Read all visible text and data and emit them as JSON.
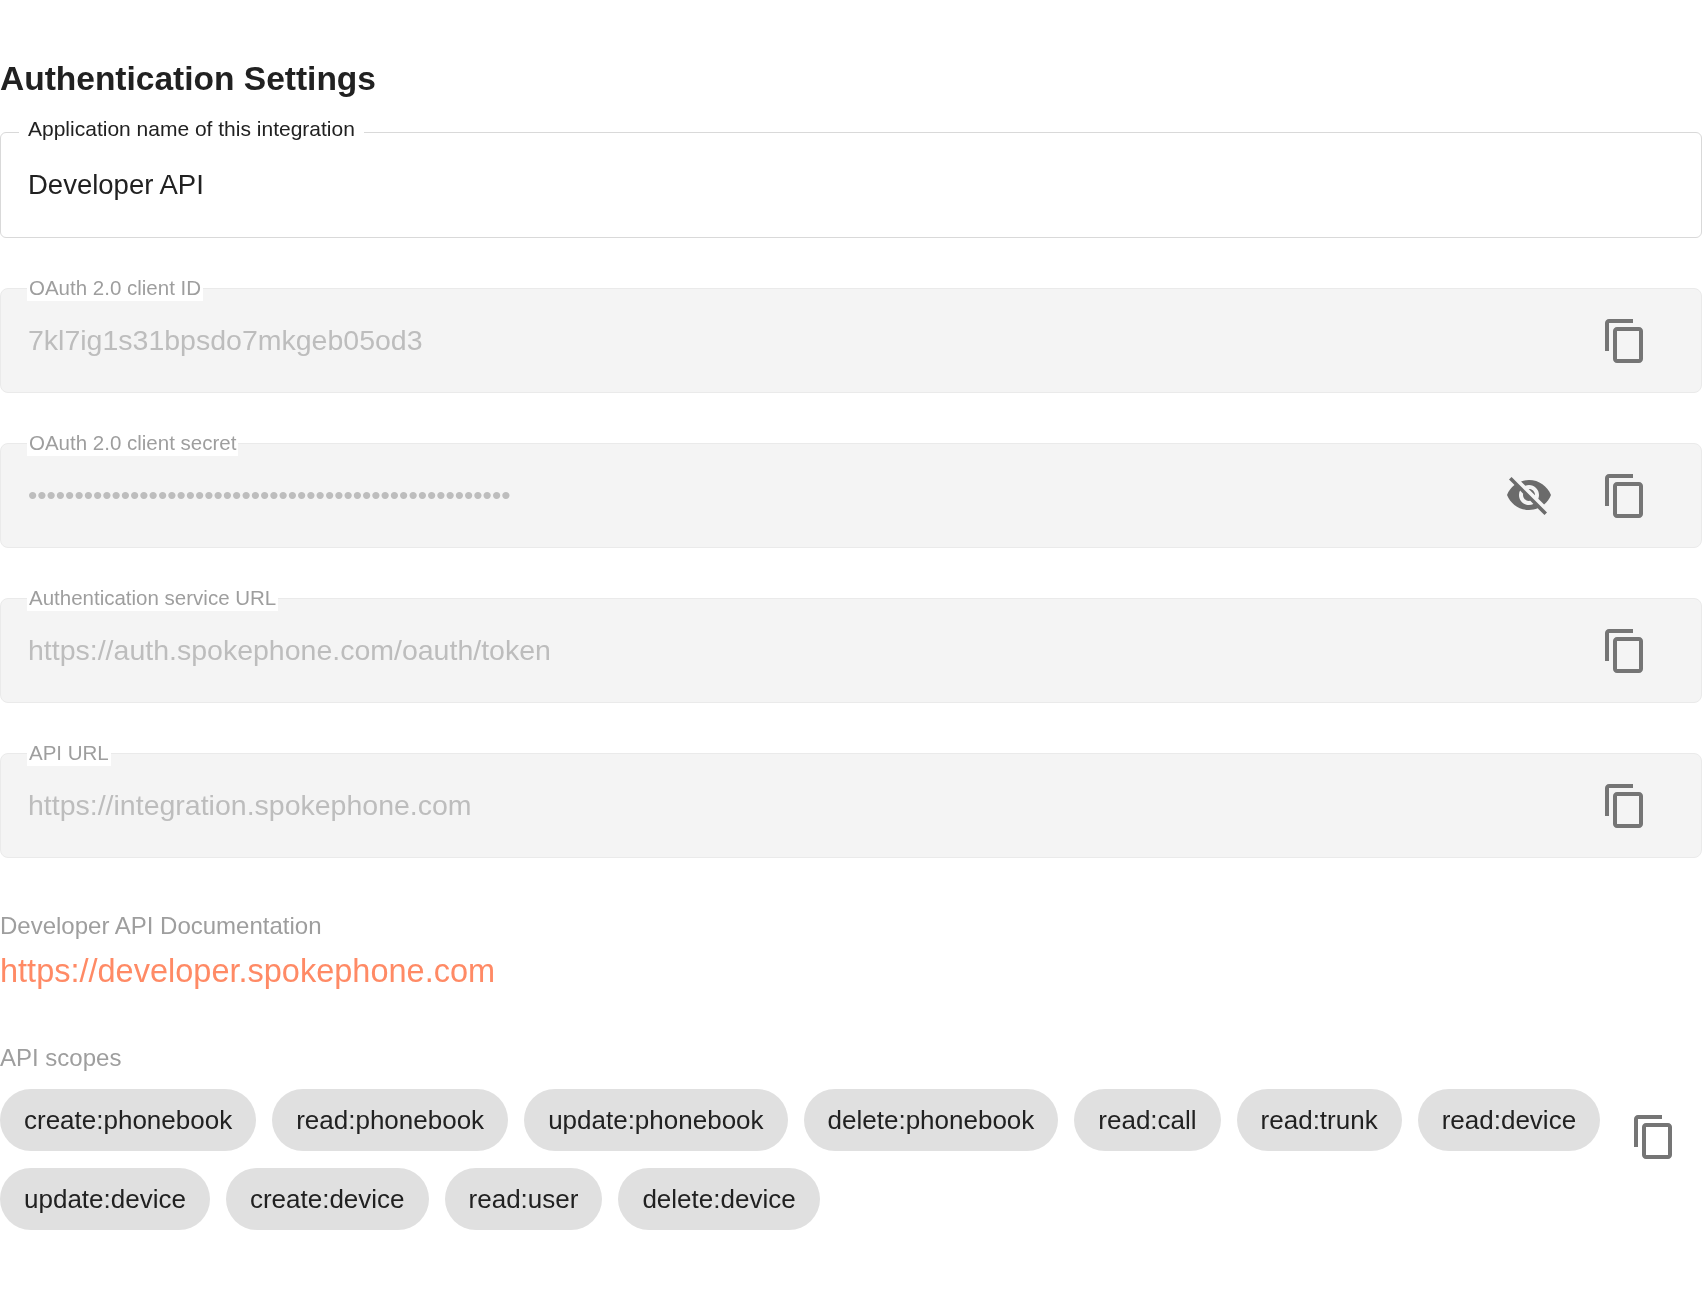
{
  "title": "Authentication Settings",
  "fields": [
    {
      "kind": "text",
      "label": "Application name of this integration",
      "value": "Developer API",
      "disabled": false,
      "copyable": false
    },
    {
      "kind": "text",
      "label": "OAuth 2.0 client ID",
      "value": "7kl7ig1s31bpsdo7mkgeb05od3",
      "disabled": true,
      "copyable": true
    },
    {
      "kind": "secret",
      "label": "OAuth 2.0 client secret",
      "value": "••••••••••••••••••••••••••••••••••••••••••••••••••••",
      "disabled": true,
      "copyable": true,
      "revealed": false
    },
    {
      "kind": "text",
      "label": "Authentication service URL",
      "value": "https://auth.spokephone.com/oauth/token",
      "disabled": true,
      "copyable": true
    },
    {
      "kind": "text",
      "label": "API URL",
      "value": "https://integration.spokephone.com",
      "disabled": true,
      "copyable": true
    }
  ],
  "documentation": {
    "label": "Developer API Documentation",
    "link": "https://developer.spokephone.com"
  },
  "scopes": {
    "label": "API scopes",
    "items": [
      "create:phonebook",
      "read:phonebook",
      "update:phonebook",
      "delete:phonebook",
      "read:call",
      "read:trunk",
      "read:device",
      "update:device",
      "create:device",
      "read:user",
      "delete:device"
    ],
    "copyable": true
  }
}
